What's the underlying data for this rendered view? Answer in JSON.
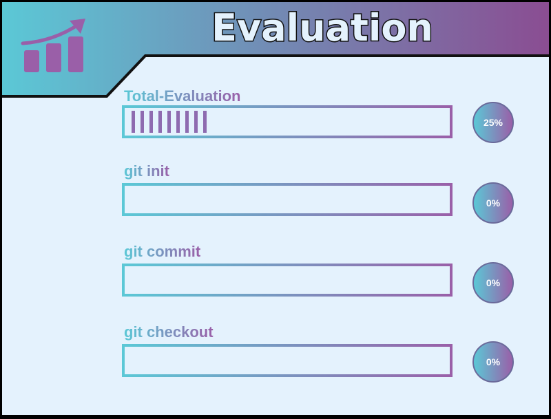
{
  "header": {
    "title": "Evaluation",
    "icon": "rising-bar-chart-icon"
  },
  "colors": {
    "accent_start": "#5bc8d6",
    "accent_end": "#9a5fa8",
    "background": "#e4f2fd"
  },
  "evaluations": [
    {
      "label": "Total-Evaluation",
      "percent_text": "25%",
      "progress": 0.25
    },
    {
      "label": "git init",
      "percent_text": "0%",
      "progress": 0
    },
    {
      "label": "git commit",
      "percent_text": "0%",
      "progress": 0
    },
    {
      "label": "git checkout",
      "percent_text": "0%",
      "progress": 0
    }
  ]
}
